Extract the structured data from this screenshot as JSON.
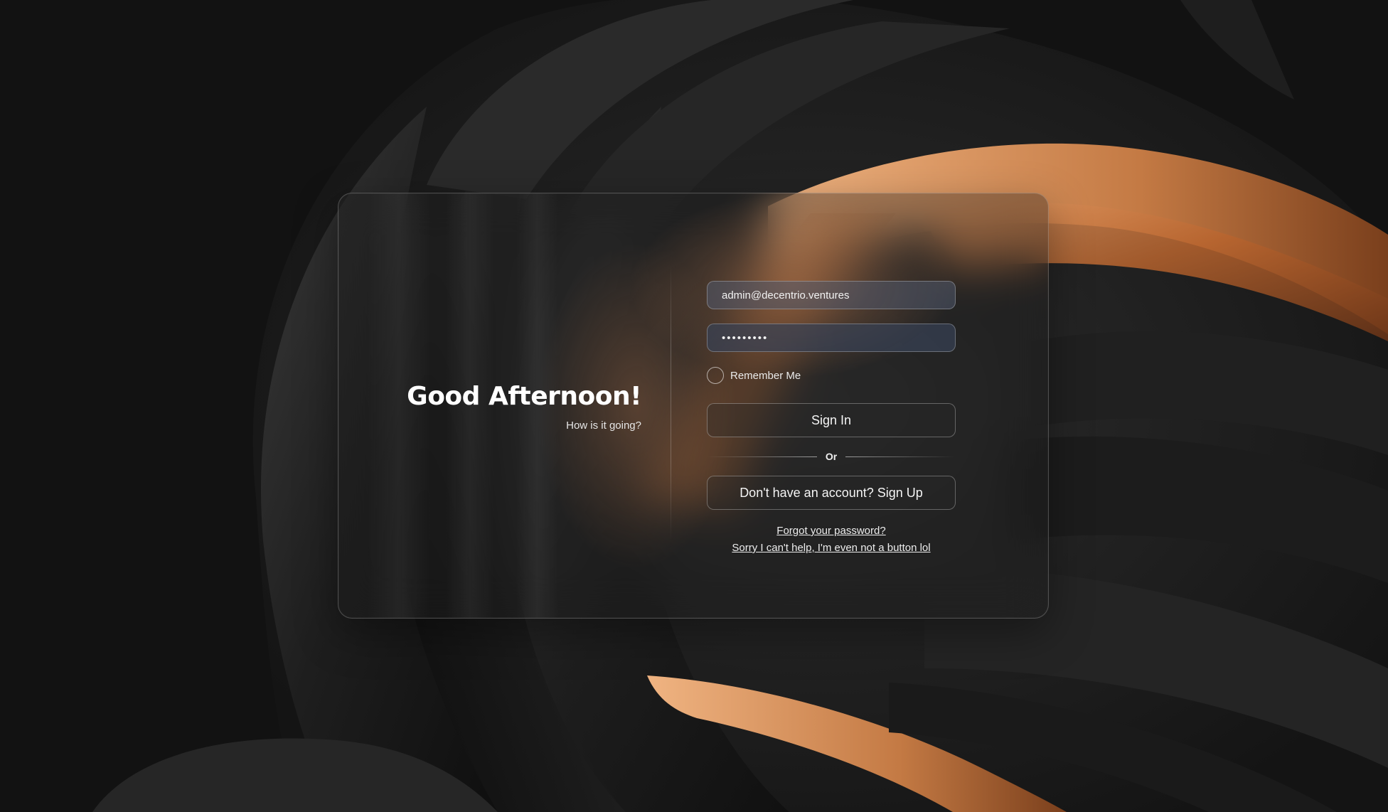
{
  "greeting": {
    "title": "Good Afternoon!",
    "subtitle": "How is it going?"
  },
  "login_form": {
    "email_value": "admin@decentrio.ventures",
    "password_value": "•••••••••",
    "remember_label": "Remember Me",
    "remember_checked": false,
    "sign_in_label": "Sign In",
    "or_label": "Or",
    "sign_up_label": "Don't have an account? Sign Up",
    "forgot_label": "Forgot your password?",
    "joke_label": "Sorry I can't help, I'm even not a button lol"
  },
  "colors": {
    "background": "#121212",
    "accent_orange": "#c87a45",
    "text": "#ffffff"
  }
}
